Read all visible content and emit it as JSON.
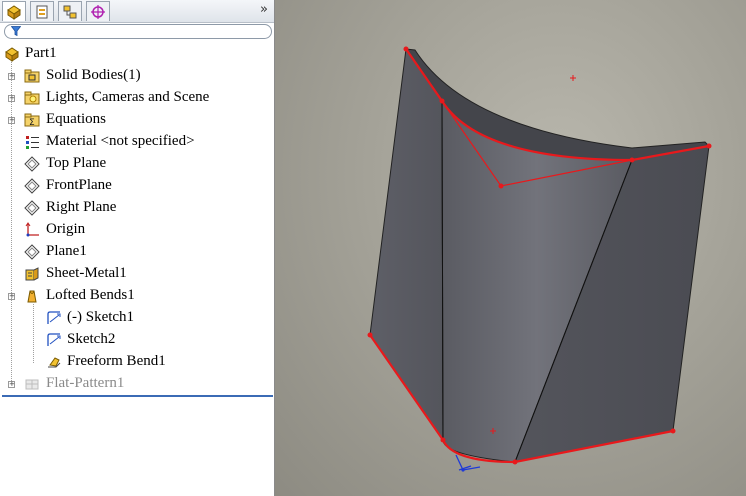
{
  "feature_manager": {
    "tabs": [
      {
        "icon": "feature-manager-tab-icon"
      },
      {
        "icon": "property-manager-tab-icon"
      },
      {
        "icon": "configuration-manager-tab-icon"
      },
      {
        "icon": "dimxpert-manager-tab-icon"
      }
    ],
    "more_glyph": "»",
    "filter_icon": "filter-icon",
    "tree": [
      {
        "label": "Part1",
        "icon": "part-icon",
        "level": 0,
        "expander": false
      },
      {
        "label": "Solid Bodies(1)",
        "icon": "solid-bodies-folder-icon",
        "level": 1,
        "expander": true
      },
      {
        "label": "Lights, Cameras and Scene",
        "icon": "lights-folder-icon",
        "level": 1,
        "expander": true
      },
      {
        "label": "Equations",
        "icon": "equations-folder-icon",
        "level": 1,
        "expander": true
      },
      {
        "label": "Material <not specified>",
        "icon": "material-icon",
        "level": 1,
        "expander": false
      },
      {
        "label": "Top Plane",
        "icon": "plane-icon",
        "level": 1,
        "expander": false
      },
      {
        "label": "FrontPlane",
        "icon": "plane-icon",
        "level": 1,
        "expander": false
      },
      {
        "label": "Right Plane",
        "icon": "plane-icon",
        "level": 1,
        "expander": false
      },
      {
        "label": "Origin",
        "icon": "origin-icon",
        "level": 1,
        "expander": false
      },
      {
        "label": "Plane1",
        "icon": "plane-icon",
        "level": 1,
        "expander": false
      },
      {
        "label": "Sheet-Metal1",
        "icon": "sheet-metal-icon",
        "level": 1,
        "expander": false
      },
      {
        "label": "Lofted Bends1",
        "icon": "lofted-bends-icon",
        "level": 1,
        "expander": true
      },
      {
        "label": "(-) Sketch1",
        "icon": "sketch-icon",
        "level": 2,
        "expander": false
      },
      {
        "label": "Sketch2",
        "icon": "sketch-icon",
        "level": 2,
        "expander": false
      },
      {
        "label": "Freeform Bend1",
        "icon": "freeform-bend-icon",
        "level": 2,
        "expander": false
      },
      {
        "label": "Flat-Pattern1",
        "icon": "flat-pattern-icon",
        "level": 1,
        "expander": true,
        "suppressed": true
      }
    ]
  },
  "colors": {
    "selection_edge": "#e8191c",
    "body_dark": "#4f5057",
    "body_light": "#6a6b73",
    "rollback_bar": "#3b6bb5",
    "suppressed_text": "#8a8a8a"
  }
}
